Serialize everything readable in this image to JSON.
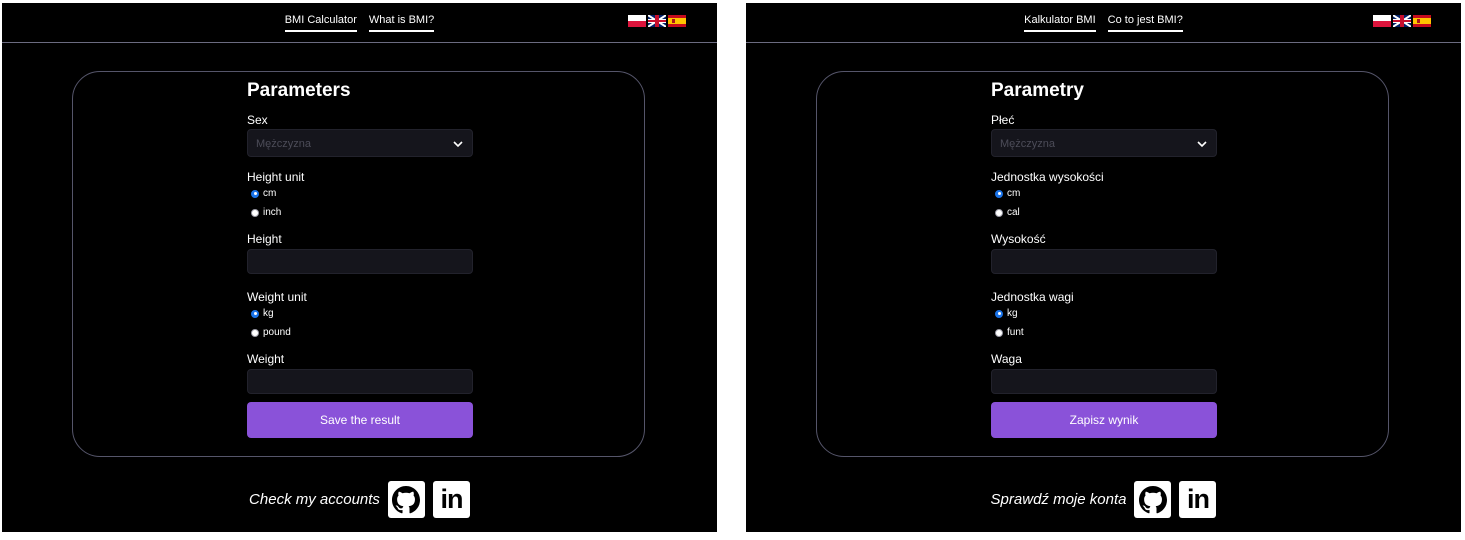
{
  "panels": [
    {
      "language": "en",
      "nav": {
        "calculator": "BMI Calculator",
        "what_is": "What is BMI?"
      },
      "flags": [
        "poland-flag",
        "uk-flag",
        "spain-flag"
      ],
      "form": {
        "title": "Parameters",
        "sex_label": "Sex",
        "sex_value": "Mężczyzna",
        "height_unit_label": "Height unit",
        "height_units": [
          {
            "label": "cm",
            "checked": true
          },
          {
            "label": "inch",
            "checked": false
          }
        ],
        "height_label": "Height",
        "height_value": "",
        "weight_unit_label": "Weight unit",
        "weight_units": [
          {
            "label": "kg",
            "checked": true
          },
          {
            "label": "pound",
            "checked": false
          }
        ],
        "weight_label": "Weight",
        "weight_value": "",
        "save_label": "Save the result"
      },
      "footer": {
        "text": "Check my accounts",
        "icons": [
          "github-icon",
          "linkedin-icon"
        ]
      }
    },
    {
      "language": "pl",
      "nav": {
        "calculator": "Kalkulator BMI",
        "what_is": "Co to jest BMI?"
      },
      "flags": [
        "poland-flag",
        "uk-flag",
        "spain-flag"
      ],
      "form": {
        "title": "Parametry",
        "sex_label": "Płeć",
        "sex_value": "Mężczyzna",
        "height_unit_label": "Jednostka wysokości",
        "height_units": [
          {
            "label": "cm",
            "checked": true
          },
          {
            "label": "cal",
            "checked": false
          }
        ],
        "height_label": "Wysokość",
        "height_value": "",
        "weight_unit_label": "Jednostka wagi",
        "weight_units": [
          {
            "label": "kg",
            "checked": true
          },
          {
            "label": "funt",
            "checked": false
          }
        ],
        "weight_label": "Waga",
        "weight_value": "",
        "save_label": "Zapisz wynik"
      },
      "footer": {
        "text": "Sprawdź moje konta",
        "icons": [
          "github-icon",
          "linkedin-icon"
        ]
      }
    }
  ],
  "colors": {
    "background": "#000000",
    "accent": "#8a52d9",
    "input_bg": "#15151c",
    "radio_checked": "#1a73e8",
    "border": "#55556a"
  }
}
